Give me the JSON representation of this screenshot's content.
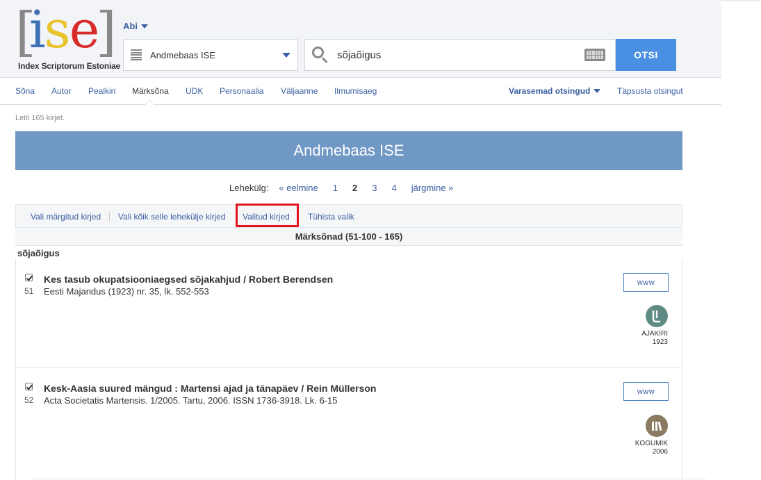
{
  "logo": {
    "bracket_left": "[",
    "bracket_right": "]",
    "letter_i": "i",
    "letter_s": "s",
    "letter_e": "e",
    "tagline": "Index Scriptorum Estoniae"
  },
  "header": {
    "help_label": "Abi"
  },
  "database_select": {
    "value": "Andmebaas ISE"
  },
  "search": {
    "value": "sõjaõigus",
    "button_label": "OTSI"
  },
  "tabs": [
    {
      "label": "Sõna"
    },
    {
      "label": "Autor"
    },
    {
      "label": "Pealkiri"
    },
    {
      "label": "Märksõna",
      "active": true
    },
    {
      "label": "UDK"
    },
    {
      "label": "Personaalia"
    },
    {
      "label": "Väljaanne"
    },
    {
      "label": "Ilmumisaeg"
    }
  ],
  "previous_searches_label": "Varasemad otsingud",
  "refine_search_label": "Täpsusta otsingut",
  "found_text": "Leiti 165 kirjet.",
  "banner_title": "Andmebaas ISE",
  "pager": {
    "label": "Lehekülg:",
    "prev": "« eelmine",
    "pages": [
      "1",
      "2",
      "3",
      "4"
    ],
    "current": "2",
    "next": "järgmine »"
  },
  "selection_actions": {
    "select_marked": "Vali märgitud kirjed",
    "select_page": "Vali kõik selle lehekülje kirjed",
    "selected": "Valitud kirjed",
    "clear": "Tühista valik"
  },
  "section_header": "Märksõnad (51-100 - 165)",
  "keyword": "sõjaõigus",
  "records": [
    {
      "number": "51",
      "checked": true,
      "title": "Kes tasub okupatsiooniaegsed sõjakahjud / Robert Berendsen",
      "source": "Eesti Majandus (1923) nr. 35, lk. 552-553",
      "www_label": "www",
      "type": "AJAKIRI",
      "year": "1923"
    },
    {
      "number": "52",
      "checked": true,
      "title": "Kesk-Aasia suured mängud : Martensi ajad ja tänapäev / Rein Müllerson",
      "source": "Acta Societatis Martensis. 1/2005. Tartu, 2006. ISSN 1736-3918. Lk. 6-15",
      "www_label": "www",
      "type": "KOGUMIK",
      "year": "2006"
    }
  ],
  "colors": {
    "brand_blue": "#4a90e2",
    "link_blue": "#3a5fa0",
    "banner_blue": "#7098c5",
    "highlight_red": "#e0141e"
  }
}
